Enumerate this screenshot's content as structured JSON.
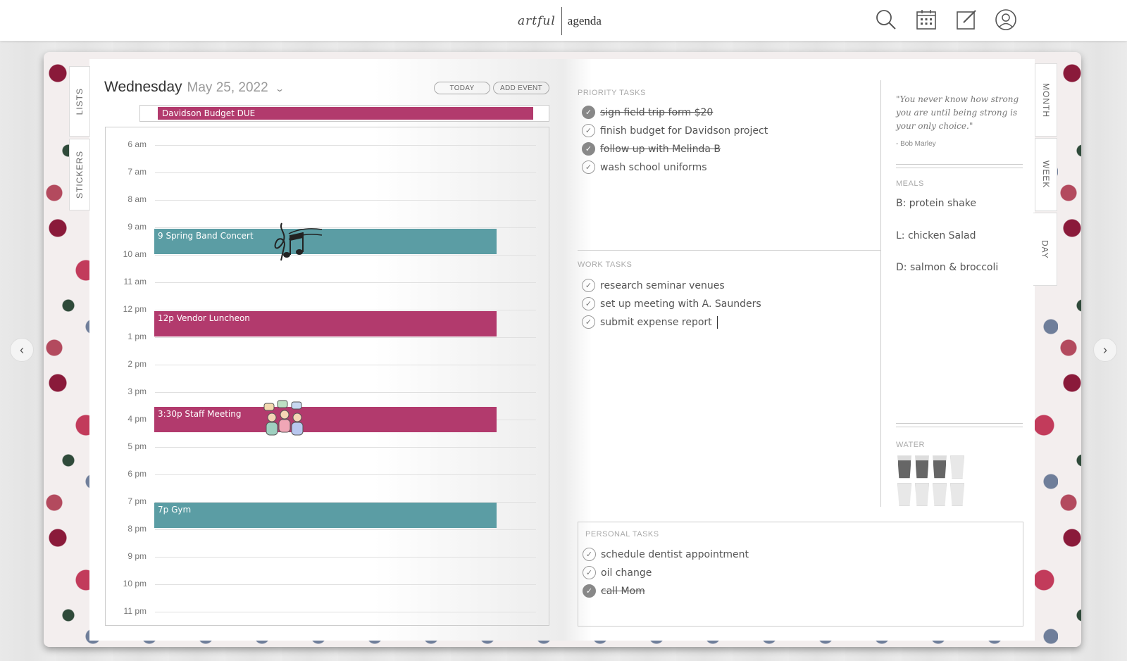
{
  "app": {
    "logo_left": "artful",
    "logo_right": "agenda"
  },
  "header_icons": [
    "search-icon",
    "calendar-icon",
    "edit-icon",
    "user-icon"
  ],
  "side_tabs_left": [
    {
      "label": "LISTS"
    },
    {
      "label": "STICKERS"
    }
  ],
  "side_tabs_right": [
    {
      "label": "MONTH"
    },
    {
      "label": "WEEK"
    },
    {
      "label": "DAY"
    }
  ],
  "day": {
    "weekday": "Wednesday",
    "date": "May 25, 2022",
    "today_label": "TODAY",
    "add_event_label": "ADD EVENT",
    "all_day_event": "Davidson Budget DUE"
  },
  "hours": [
    "6 am",
    "7 am",
    "8 am",
    "9 am",
    "10 am",
    "11 am",
    "12 pm",
    "1 pm",
    "2 pm",
    "3 pm",
    "4 pm",
    "5 pm",
    "6 pm",
    "7 pm",
    "8 pm",
    "9 pm",
    "10 pm",
    "11 pm"
  ],
  "events": [
    {
      "label": "9 Spring Band Concert",
      "color": "#5b9da4"
    },
    {
      "label": "12p Vendor Luncheon",
      "color": "#b23a6d"
    },
    {
      "label": "3:30p Staff Meeting",
      "color": "#b23a6d"
    },
    {
      "label": "7p Gym",
      "color": "#5b9da4"
    }
  ],
  "priority_tasks": {
    "title": "PRIORITY TASKS",
    "items": [
      {
        "text": "sign field trip form $20",
        "done": true
      },
      {
        "text": "finish budget for Davidson project",
        "done": false
      },
      {
        "text": "follow up with Melinda B",
        "done": true
      },
      {
        "text": "wash school uniforms",
        "done": false
      }
    ]
  },
  "work_tasks": {
    "title": "WORK TASKS",
    "items": [
      {
        "text": "research seminar venues",
        "done": false
      },
      {
        "text": "set up meeting with A. Saunders",
        "done": false
      },
      {
        "text": "submit expense report",
        "done": false
      }
    ]
  },
  "personal_tasks": {
    "title": "PERSONAL TASKS",
    "items": [
      {
        "text": "schedule dentist appointment",
        "done": false
      },
      {
        "text": "oil change",
        "done": false
      },
      {
        "text": "call Mom",
        "done": true
      }
    ]
  },
  "quote": {
    "text": "\"You never know how strong you are until being strong is your only choice.\"",
    "author": "- Bob Marley"
  },
  "meals": {
    "title": "MEALS",
    "breakfast": "B: protein shake",
    "lunch": "L: chicken Salad",
    "dinner": "D: salmon & broccoli"
  },
  "water": {
    "title": "WATER",
    "filled": 3,
    "total": 8
  },
  "colors": {
    "pink": "#b23a6d",
    "teal": "#5b9da4"
  }
}
